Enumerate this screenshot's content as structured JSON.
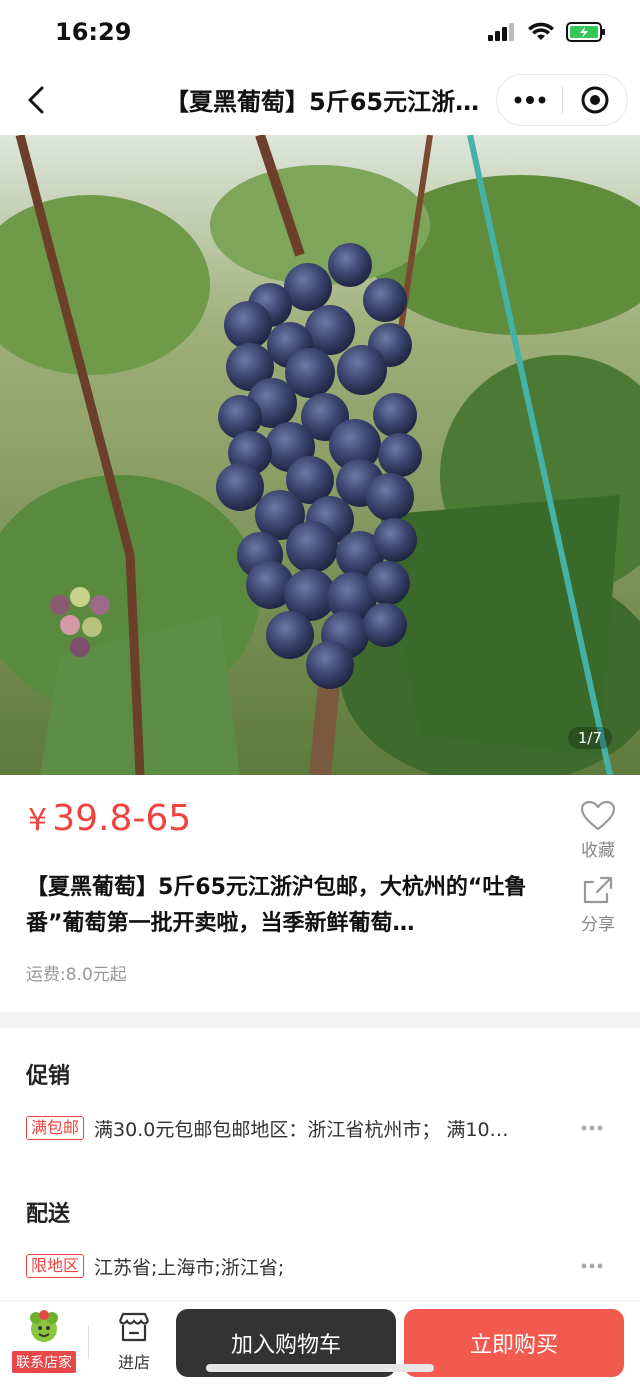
{
  "status_bar": {
    "time": "16:29"
  },
  "nav": {
    "title": "【夏黑葡萄】5斤65元江浙沪包邮，大杭州的“吐鲁番”葡萄第一批开卖啦，当季新鲜葡萄…"
  },
  "photo": {
    "counter": "1/7"
  },
  "price": {
    "symbol": "¥",
    "value": "39.8-65",
    "color": "#f0433f"
  },
  "favorite": {
    "label": "收藏"
  },
  "share": {
    "label": "分享"
  },
  "product": {
    "title": "【夏黑葡萄】5斤65元江浙沪包邮，大杭州的“吐鲁番”葡萄第一批开卖啦，当季新鲜葡萄…",
    "shipping_fee": "运费:8.0元起"
  },
  "promotion": {
    "section_title": "促销",
    "tag": "满包邮",
    "text": "满30.0元包邮包邮地区：浙江省杭州市；  满10…"
  },
  "delivery": {
    "section_title": "配送",
    "tag": "限地区",
    "text": "江苏省;上海市;浙江省;"
  },
  "bottom_bar": {
    "contact_label": "联系店家",
    "store_label": "进店",
    "add_to_cart": "加入购物车",
    "buy_now": "立即购买",
    "cart_color": "#333333",
    "buy_color": "#f25a4f"
  },
  "icons": {
    "back": "chevron-left-icon",
    "more": "more-dots-icon",
    "close": "target-close-icon",
    "favorite": "heart-icon",
    "share": "share-icon",
    "store": "store-icon",
    "ellipsis": "ellipsis-icon"
  }
}
